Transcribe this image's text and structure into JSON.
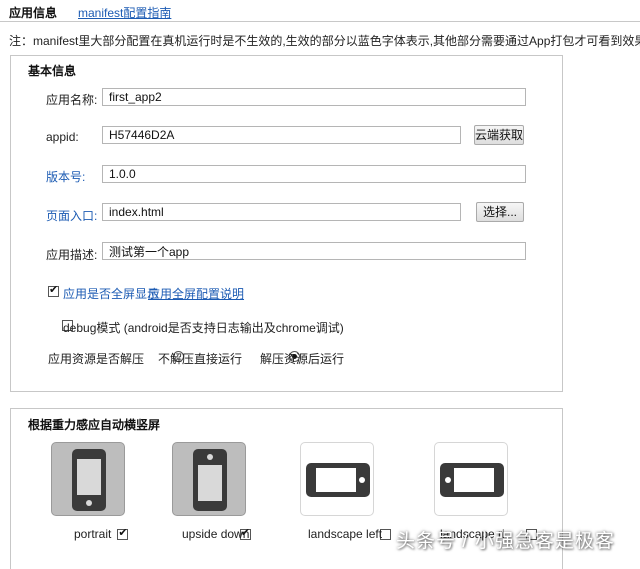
{
  "tabs": {
    "active": "应用信息",
    "guide": "manifest配置指南"
  },
  "note": "注：manifest里大部分配置在真机运行时是不生效的,生效的部分以蓝色字体表示,其他部分需要通过App打包才可看到效果",
  "basic": {
    "title": "基本信息",
    "app_name_label": "应用名称:",
    "app_name_value": "first_app2",
    "appid_label": "appid:",
    "appid_value": "H57446D2A",
    "cloud_button": "云端获取",
    "version_label": "版本号:",
    "version_value": "1.0.0",
    "entry_label": "页面入口:",
    "entry_value": "index.html",
    "choose_button": "选择...",
    "desc_label": "应用描述:",
    "desc_value": "测试第一个app",
    "fullscreen_label": "应用是否全屏显示",
    "fullscreen_checked": true,
    "fullscreen_link": "应用全屏配置说明",
    "debug_label": "debug模式 (android是否支持日志输出及chrome调试)",
    "debug_checked": false,
    "unzip_label": "应用资源是否解压",
    "unzip_options": [
      "不解压直接运行",
      "解压资源后运行"
    ],
    "unzip_selected": 1
  },
  "orientation": {
    "title": "根据重力感应自动横竖屏",
    "items": [
      {
        "label": "portrait",
        "checked": true,
        "icon": "phone-portrait-icon"
      },
      {
        "label": "upside down",
        "checked": true,
        "icon": "phone-portrait-icon"
      },
      {
        "label": "landscape left",
        "checked": false,
        "icon": "phone-landscape-icon"
      },
      {
        "label": "landscape ri",
        "checked": false,
        "icon": "phone-landscape-icon"
      }
    ]
  },
  "watermark": "头条号 / 小强急客是极客"
}
